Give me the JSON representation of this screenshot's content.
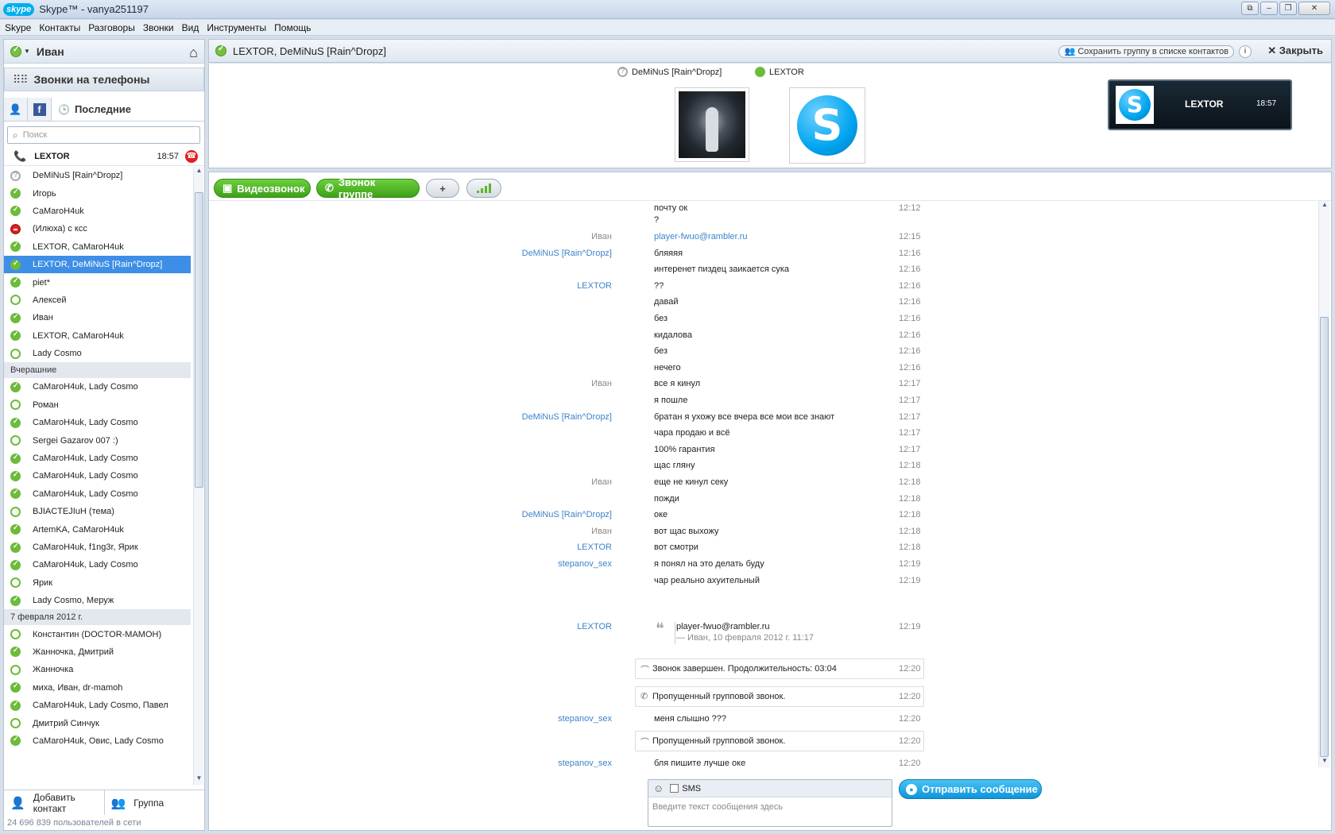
{
  "window": {
    "logo": "skype",
    "title": "Skype™ - vanya251197",
    "controls": [
      "⧉",
      "–",
      "❐",
      "✕"
    ]
  },
  "menu": [
    "Skype",
    "Контакты",
    "Разговоры",
    "Звонки",
    "Вид",
    "Инструменты",
    "Помощь"
  ],
  "user": {
    "name": "Иван",
    "status": "online"
  },
  "phones_label": "Звонки на телефоны",
  "tabs": {
    "recent": "Последние"
  },
  "search": {
    "placeholder": "Поиск"
  },
  "active_call": {
    "name": "LEXTOR",
    "time": "18:57"
  },
  "contacts": [
    {
      "name": "DeMiNuS [Rain^Dropz]",
      "status": "unk"
    },
    {
      "name": "Игорь",
      "status": "on"
    },
    {
      "name": "CaMaroH4uk",
      "status": "on"
    },
    {
      "name": "(Илюха) с ксс",
      "status": "busy"
    },
    {
      "name": "LEXTOR, CaMaroH4uk",
      "status": "on"
    },
    {
      "name": "LEXTOR, DeMiNuS [Rain^Dropz]",
      "status": "on",
      "selected": true
    },
    {
      "name": "piet*",
      "status": "on"
    },
    {
      "name": "Алексей",
      "status": "off"
    },
    {
      "name": "Иван",
      "status": "on"
    },
    {
      "name": "LEXTOR, CaMaroH4uk",
      "status": "on"
    },
    {
      "name": "Lady Cosmo",
      "status": "off"
    },
    {
      "header": "Вчерашние"
    },
    {
      "name": "CaMaroH4uk, Lady Cosmo",
      "status": "on"
    },
    {
      "name": "Роман",
      "status": "off"
    },
    {
      "name": "CaMaroH4uk, Lady Cosmo",
      "status": "on"
    },
    {
      "name": "Sergei Gazarov 007 :)",
      "status": "off"
    },
    {
      "name": "CaMaroH4uk, Lady Cosmo",
      "status": "on"
    },
    {
      "name": "CaMaroH4uk, Lady Cosmo",
      "status": "on"
    },
    {
      "name": "CaMaroH4uk, Lady Cosmo",
      "status": "on"
    },
    {
      "name": "BJIACTEJIuH (тема)",
      "status": "off"
    },
    {
      "name": "ArtemKA, CaMaroH4uk",
      "status": "on"
    },
    {
      "name": "CaMaroH4uk, f1ng3r, Ярик",
      "status": "on"
    },
    {
      "name": "CaMaroH4uk, Lady Cosmo",
      "status": "on"
    },
    {
      "name": "Ярик",
      "status": "off"
    },
    {
      "name": "Lady Cosmo, Меруж",
      "status": "on"
    },
    {
      "header": "7 февраля 2012 г."
    },
    {
      "name": "Константин (DOCTOR-MAMOH)",
      "status": "off"
    },
    {
      "name": "Жанночка, Дмитрий",
      "status": "on"
    },
    {
      "name": "Жанночка",
      "status": "off"
    },
    {
      "name": "миха, Иван, dr-mamoh",
      "status": "on"
    },
    {
      "name": "CaMaroH4uk, Lady Cosmo, Павел",
      "status": "on"
    },
    {
      "name": "Дмитрий Синчук",
      "status": "off"
    },
    {
      "name": "CaMaroH4uk, Овис, Lady Cosmo",
      "status": "on"
    }
  ],
  "footer": {
    "add_contact": "Добавить контакт",
    "group": "Группа",
    "online_count": "24 696 839 пользователей в сети"
  },
  "conversation": {
    "title": "LEXTOR, DeMiNuS [Rain^Dropz]",
    "save_group": "Сохранить группу в списке контактов",
    "info": "i",
    "close": "Закрыть",
    "participants": [
      {
        "name": "DeMiNuS [Rain^Dropz]"
      },
      {
        "name": "LEXTOR"
      }
    ],
    "call": {
      "name": "LEXTOR",
      "time": "18:57"
    },
    "buttons": {
      "video": "Видеозвонок",
      "group_call": "Звонок группе",
      "add": "+"
    }
  },
  "messages": [
    {
      "sender": "",
      "text": "почту ок",
      "time": "12:12"
    },
    {
      "sender": "",
      "text": "?",
      "time": ""
    },
    {
      "sender": "Иван",
      "text": "player-fwuo@rambler.ru",
      "time": "12:15",
      "me": true,
      "link": true
    },
    {
      "sender": "DeMiNuS [Rain^Dropz]",
      "text": "бляяяя",
      "time": "12:16"
    },
    {
      "sender": "",
      "text": "интеренет пиздец заикается сука",
      "time": "12:16"
    },
    {
      "sender": "LEXTOR",
      "text": "??",
      "time": "12:16"
    },
    {
      "sender": "",
      "text": "давай",
      "time": "12:16"
    },
    {
      "sender": "",
      "text": "без",
      "time": "12:16"
    },
    {
      "sender": "",
      "text": "кидалова",
      "time": "12:16"
    },
    {
      "sender": "",
      "text": "без",
      "time": "12:16"
    },
    {
      "sender": "",
      "text": "нечего",
      "time": "12:16"
    },
    {
      "sender": "Иван",
      "text": "все я кинул",
      "time": "12:17",
      "me": true
    },
    {
      "sender": "",
      "text": "я пошле",
      "time": "12:17"
    },
    {
      "sender": "DeMiNuS [Rain^Dropz]",
      "text": "братан я ухожу все вчера все мои все знают",
      "time": "12:17"
    },
    {
      "sender": "",
      "text": "чара продаю и всё",
      "time": "12:17"
    },
    {
      "sender": "",
      "text": "100% гарантия",
      "time": "12:17"
    },
    {
      "sender": "",
      "text": "щас гляну",
      "time": "12:18"
    },
    {
      "sender": "Иван",
      "text": "еще не кинул секу",
      "time": "12:18",
      "me": true
    },
    {
      "sender": "",
      "text": "пожди",
      "time": "12:18"
    },
    {
      "sender": "DeMiNuS [Rain^Dropz]",
      "text": "оке",
      "time": "12:18"
    },
    {
      "sender": "Иван",
      "text": "вот щас выхожу",
      "time": "12:18",
      "me": true
    },
    {
      "sender": "LEXTOR",
      "text": "вот смотри",
      "time": "12:18"
    },
    {
      "sender": "stepanov_sex",
      "text": "я понял на это делать буду",
      "time": "12:19"
    },
    {
      "sender": "",
      "text": "чар реально ахуительный",
      "time": "12:19"
    }
  ],
  "quote_msg": {
    "sender": "LEXTOR",
    "text": "player-fwuo@rambler.ru",
    "meta": "— Иван, 10 февраля 2012 г. 11:17",
    "time": "12:19"
  },
  "system1": {
    "text": "Звонок завершен. Продолжительность: 03:04",
    "time": "12:20"
  },
  "system2": {
    "text": "Пропущенный групповой звонок.",
    "time": "12:20"
  },
  "msg_after1": {
    "sender": "stepanov_sex",
    "text": "меня слышно ???",
    "time": "12:20"
  },
  "system3": {
    "text": "Пропущенный групповой звонок.",
    "time": "12:20"
  },
  "msg_after2": {
    "sender": "stepanov_sex",
    "text": "бля пишите лучше оке",
    "time": "12:20"
  },
  "composer": {
    "sms_label": "SMS",
    "placeholder": "Введите текст сообщения здесь",
    "send": "Отправить сообщение"
  }
}
